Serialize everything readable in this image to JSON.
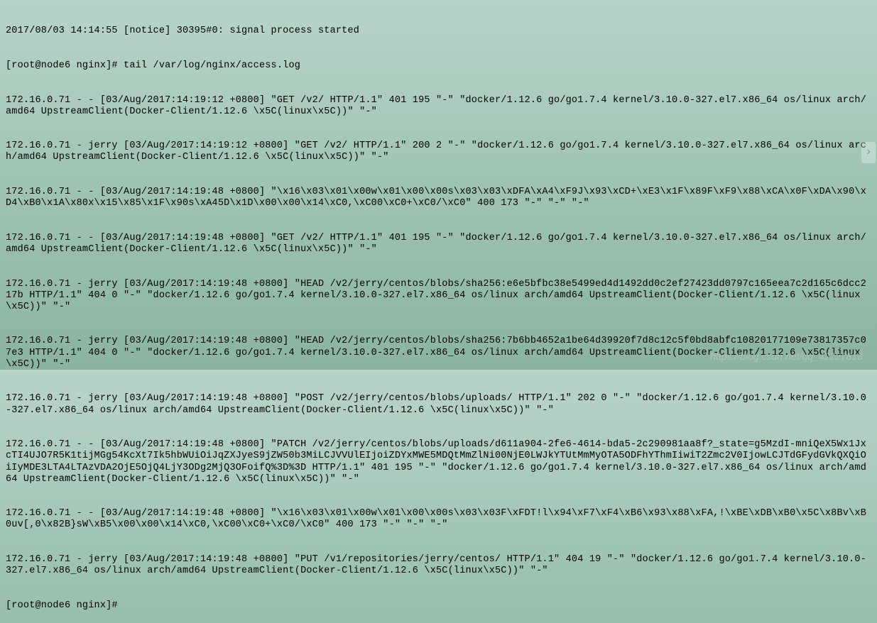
{
  "terminal": {
    "lines": [
      "2017/08/03 14:14:55 [notice] 30395#0: signal process started",
      "[root@node6 nginx]# tail /var/log/nginx/access.log",
      "172.16.0.71 - - [03/Aug/2017:14:19:12 +0800] \"GET /v2/ HTTP/1.1\" 401 195 \"-\" \"docker/1.12.6 go/go1.7.4 kernel/3.10.0-327.el7.x86_64 os/linux arch/amd64 UpstreamClient(Docker-Client/1.12.6 \\x5C(linux\\x5C))\" \"-\"",
      "172.16.0.71 - jerry [03/Aug/2017:14:19:12 +0800] \"GET /v2/ HTTP/1.1\" 200 2 \"-\" \"docker/1.12.6 go/go1.7.4 kernel/3.10.0-327.el7.x86_64 os/linux arch/amd64 UpstreamClient(Docker-Client/1.12.6 \\x5C(linux\\x5C))\" \"-\"",
      "172.16.0.71 - - [03/Aug/2017:14:19:48 +0800] \"\\x16\\x03\\x01\\x00w\\x01\\x00\\x00s\\x03\\x03\\xDFA\\xA4\\xF9J\\x93\\xCD+\\xE3\\x1F\\x89F\\xF9\\x88\\xCA\\x0F\\xDA\\x90\\xD4\\xB0\\x1A\\x80x\\x15\\x85\\x1F\\x90s\\xA45D\\x1D\\x00\\x00\\x14\\xC0,\\xC00\\xC0+\\xC0/\\xC0\" 400 173 \"-\" \"-\" \"-\"",
      "172.16.0.71 - - [03/Aug/2017:14:19:48 +0800] \"GET /v2/ HTTP/1.1\" 401 195 \"-\" \"docker/1.12.6 go/go1.7.4 kernel/3.10.0-327.el7.x86_64 os/linux arch/amd64 UpstreamClient(Docker-Client/1.12.6 \\x5C(linux\\x5C))\" \"-\"",
      "172.16.0.71 - jerry [03/Aug/2017:14:19:48 +0800] \"HEAD /v2/jerry/centos/blobs/sha256:e6e5bfbc38e5499ed4d1492dd0c2ef27423dd0797c165eea7c2d165c6dcc217b HTTP/1.1\" 404 0 \"-\" \"docker/1.12.6 go/go1.7.4 kernel/3.10.0-327.el7.x86_64 os/linux arch/amd64 UpstreamClient(Docker-Client/1.12.6 \\x5C(linux\\x5C))\" \"-\"",
      "172.16.0.71 - jerry [03/Aug/2017:14:19:48 +0800] \"HEAD /v2/jerry/centos/blobs/sha256:7b6bb4652a1be64d39920f7d8c12c5f0bd8abfc10820177109e73817357c07e3 HTTP/1.1\" 404 0 \"-\" \"docker/1.12.6 go/go1.7.4 kernel/3.10.0-327.el7.x86_64 os/linux arch/amd64 UpstreamClient(Docker-Client/1.12.6 \\x5C(linux\\x5C))\" \"-\"",
      "172.16.0.71 - jerry [03/Aug/2017:14:19:48 +0800] \"POST /v2/jerry/centos/blobs/uploads/ HTTP/1.1\" 202 0 \"-\" \"docker/1.12.6 go/go1.7.4 kernel/3.10.0-327.el7.x86_64 os/linux arch/amd64 UpstreamClient(Docker-Client/1.12.6 \\x5C(linux\\x5C))\" \"-\"",
      "172.16.0.71 - - [03/Aug/2017:14:19:48 +0800] \"PATCH /v2/jerry/centos/blobs/uploads/d611a904-2fe6-4614-bda5-2c290981aa8f?_state=g5MzdI-mniQeX5Wx1JxcTI4UJO7R5K1tijMGg54KcXt7Ik5hbWUiOiJqZXJyeS9jZW50b3MiLCJVVUlEIjoiZDYxMWE5MDQtMmZlNi00NjE0LWJkYTUtMmMyOTA5ODFhYThmIiwiT2Zmc2V0IjowLCJTdGFydGVkQXQiOiIyMDE3LTA4LTAzVDA2OjE5OjQ4LjY3ODg2MjQ3OFoifQ%3D%3D HTTP/1.1\" 401 195 \"-\" \"docker/1.12.6 go/go1.7.4 kernel/3.10.0-327.el7.x86_64 os/linux arch/amd64 UpstreamClient(Docker-Client/1.12.6 \\x5C(linux\\x5C))\" \"-\"",
      "172.16.0.71 - - [03/Aug/2017:14:19:48 +0800] \"\\x16\\x03\\x01\\x00w\\x01\\x00\\x00s\\x03\\x03F\\xFDT!l\\x94\\xF7\\xF4\\xB6\\x93\\x88\\xFA,!\\xBE\\xDB\\xB0\\x5C\\x8Bv\\xB0uv[,0\\x82B}sW\\xB5\\x00\\x00\\x14\\xC0,\\xC00\\xC0+\\xC0/\\xC0\" 400 173 \"-\" \"-\" \"-\"",
      "172.16.0.71 - jerry [03/Aug/2017:14:19:48 +0800] \"PUT /v1/repositories/jerry/centos/ HTTP/1.1\" 404 19 \"-\" \"docker/1.12.6 go/go1.7.4 kernel/3.10.0-327.el7.x86_64 os/linux arch/amd64 UpstreamClient(Docker-Client/1.12.6 \\x5C(linux\\x5C))\" \"-\"",
      "[root@node6 nginx]#"
    ]
  },
  "watermark": {
    "text": "https://blog.csdn.net/qq_42227818"
  },
  "nav": {
    "arrow": "›"
  }
}
